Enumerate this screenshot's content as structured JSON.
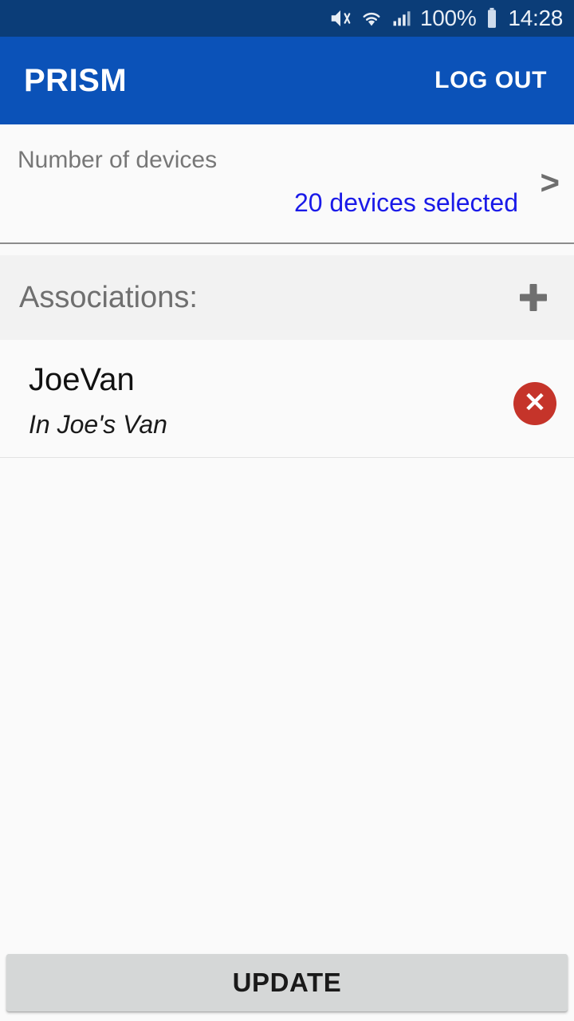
{
  "status_bar": {
    "icons": [
      "mute-vibrate-icon",
      "wifi-icon",
      "signal-bars-icon"
    ],
    "battery_percent": "100%",
    "battery_icon": "battery-full-icon",
    "time": "14:28"
  },
  "app_bar": {
    "title": "PRISM",
    "logout_label": "LOG OUT"
  },
  "devices": {
    "label": "Number of devices",
    "value": "20 devices selected",
    "chevron": ">"
  },
  "associations": {
    "title": "Associations:",
    "add_icon": "plus-icon",
    "items": [
      {
        "name": "JoeVan",
        "description": "In Joe's Van",
        "delete_icon": "close-circle-icon"
      }
    ]
  },
  "footer": {
    "update_label": "UPDATE"
  },
  "colors": {
    "status_bar": "#0b3d78",
    "app_bar": "#0b52b8",
    "accent_link": "#1a1ae8",
    "delete": "#c5342a",
    "page_bg": "#fafafa",
    "section_bg": "#f2f2f2"
  }
}
